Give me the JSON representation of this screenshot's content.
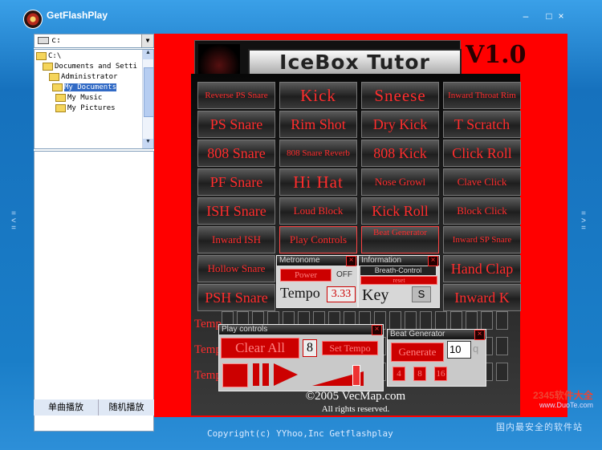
{
  "window": {
    "title": "GetFlashPlay",
    "controls": {
      "minimize": "–",
      "restore": "□",
      "close": "×"
    }
  },
  "explorer": {
    "drive": "c:",
    "tree": [
      {
        "label": "C:\\",
        "level": 0
      },
      {
        "label": "Documents and Setti",
        "level": 1
      },
      {
        "label": "Administrator",
        "level": 2
      },
      {
        "label": "My Documents",
        "level": 3,
        "selected": true
      },
      {
        "label": "My Music",
        "level": 4
      },
      {
        "label": "My Pictures",
        "level": 4
      }
    ],
    "buttons": {
      "single_play": "单曲播放",
      "random_play": "随机播放"
    }
  },
  "flash": {
    "logo_title": "IceBox Tutor",
    "version": "V1.0",
    "sound_buttons": [
      [
        "Reverse PS Snare",
        "Kick",
        "Sneese",
        "Inward Throat Rim"
      ],
      [
        "PS Snare",
        "Rim Shot",
        "Dry Kick",
        "T Scratch"
      ],
      [
        "808 Snare",
        "808 Snare Reverb",
        "808 Kick",
        "Click Roll"
      ],
      [
        "PF Snare",
        "Hi Hat",
        "Nose Growl",
        "Clave Click"
      ],
      [
        "ISH Snare",
        "Loud Block",
        "Kick Roll",
        "Block Click"
      ],
      [
        "Inward ISH",
        "Play Controls",
        "Beat Generator",
        "Inward SP Snare"
      ],
      [
        "Hollow Snare",
        "",
        "",
        "Hand Clap"
      ],
      [
        "PSH Snare",
        "",
        "",
        "Inward K"
      ]
    ],
    "metronome": {
      "title": "Metronome",
      "power": "Power",
      "off": "OFF",
      "tempo_label": "Tempo",
      "tempo_value": "3.33"
    },
    "information": {
      "title": "Information",
      "breath_control": "Breath-Control",
      "reset": "reset",
      "key_label": "Key",
      "key_value": "S"
    },
    "tempo_rows": [
      "Temp",
      "Temp",
      "Temp"
    ],
    "play_controls": {
      "title": "Play controls",
      "clear_all": "Clear All",
      "value": "8",
      "set_tempo": "Set Tempo"
    },
    "beat_generator": {
      "title": "Beat Generator",
      "generate": "Generate",
      "value": "10",
      "q": "q",
      "opt1": "4",
      "opt2": "8",
      "opt3": "16"
    },
    "copyright": "©2005 VecMap.com",
    "rights": "All rights reserved."
  },
  "statusbar": {
    "text": "Copyright(c) YYhoo,Inc Getflashplay"
  },
  "watermark": {
    "logo": "2345软件大全",
    "url": "www.DuoTe.com",
    "text": "国内最安全的软件站"
  }
}
